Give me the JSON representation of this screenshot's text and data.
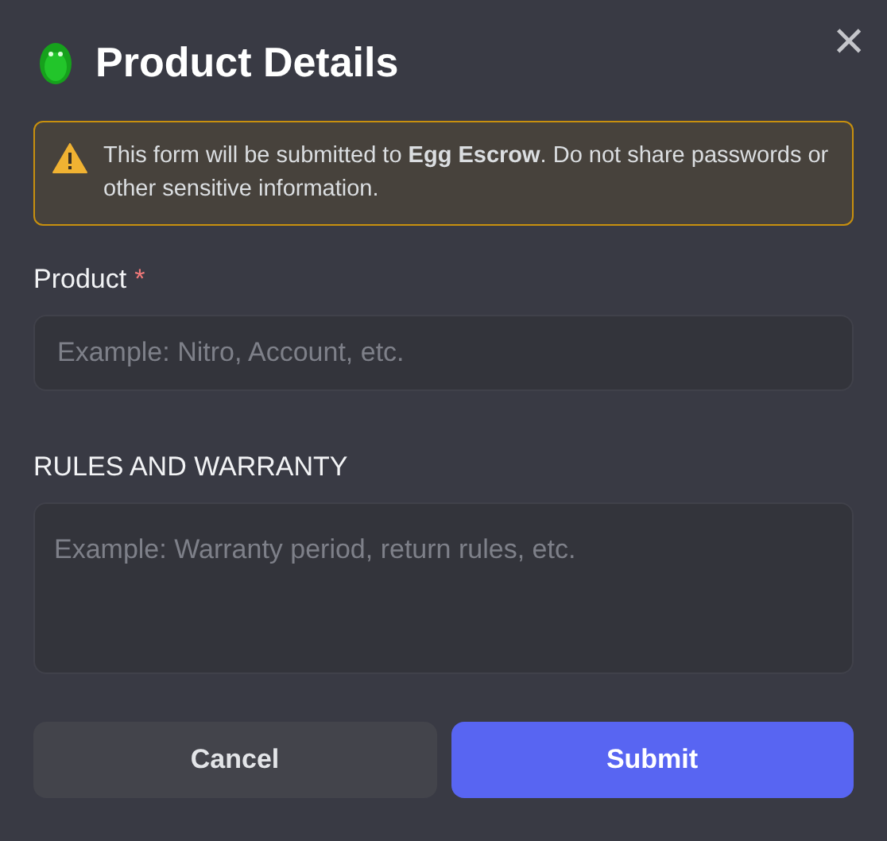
{
  "dialog": {
    "title": "Product Details",
    "close": "×"
  },
  "notice": {
    "text": "This form will be submitted to **Egg Escrow**. Do not share passwords or other sensitive information."
  },
  "fields": [
    {
      "label": "Product",
      "required_mark": "*",
      "placeholder": "Example: Nitro, Account, etc.",
      "kind": "input"
    },
    {
      "label": "RULES AND WARRANTY",
      "placeholder": "Example: Warranty period, return rules, etc.",
      "kind": "textarea"
    }
  ],
  "buttons": [
    {
      "label": "Cancel",
      "kind": "secondary"
    },
    {
      "label": "Submit",
      "kind": "primary"
    }
  ]
}
